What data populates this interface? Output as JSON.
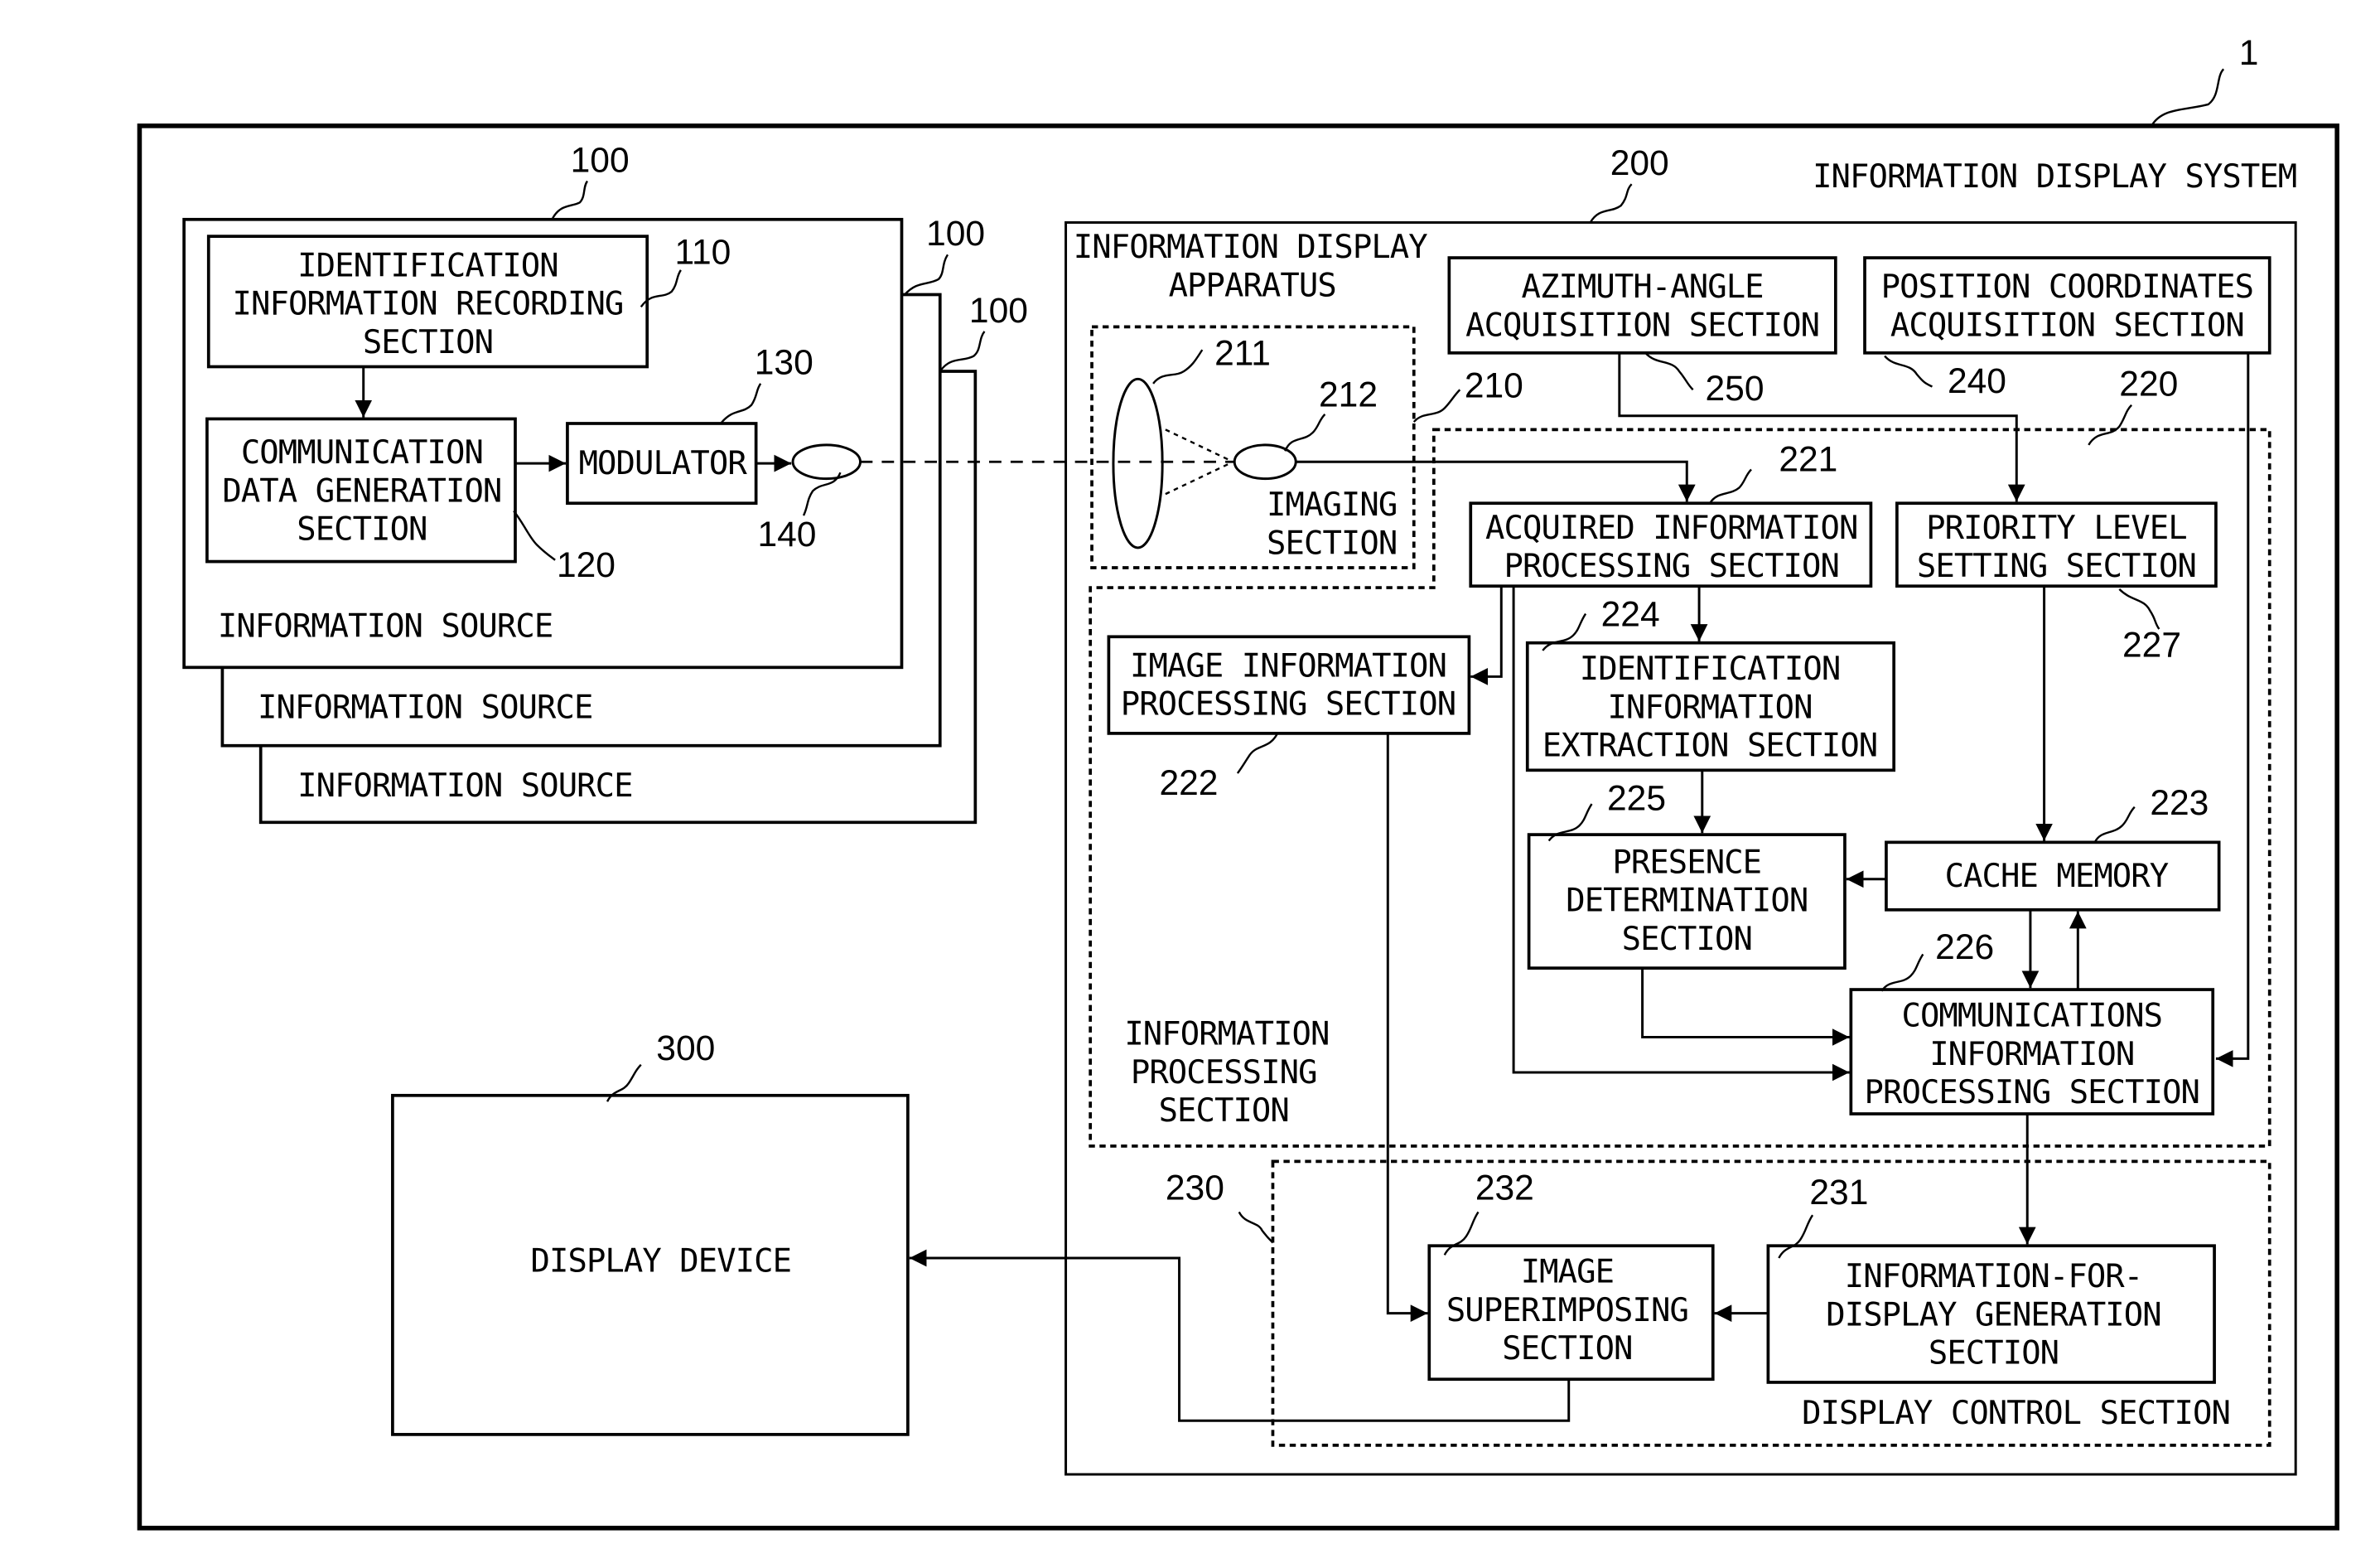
{
  "system": {
    "label": "INFORMATION DISPLAY SYSTEM",
    "ref": "1"
  },
  "sources": {
    "refs": [
      "100",
      "100",
      "100"
    ],
    "labels": [
      "INFORMATION SOURCE",
      "INFORMATION SOURCE",
      "INFORMATION SOURCE"
    ],
    "id_recording": {
      "lines": [
        "IDENTIFICATION",
        "INFORMATION RECORDING",
        "SECTION"
      ],
      "ref": "110"
    },
    "comm_data_gen": {
      "lines": [
        "COMMUNICATION",
        "DATA GENERATION",
        "SECTION"
      ],
      "ref": "120"
    },
    "modulator": {
      "label": "MODULATOR",
      "ref": "130"
    },
    "emitter_ref": "140"
  },
  "apparatus": {
    "lines": [
      "INFORMATION DISPLAY",
      "APPARATUS"
    ],
    "ref": "200",
    "imaging": {
      "lines": [
        "IMAGING",
        "SECTION"
      ],
      "ref": "210",
      "lens_ref": "211",
      "sensor_ref": "212"
    },
    "azimuth": {
      "lines": [
        "AZIMUTH-ANGLE",
        "ACQUISITION SECTION"
      ],
      "ref": "250"
    },
    "position": {
      "lines": [
        "POSITION COORDINATES",
        "ACQUISITION SECTION"
      ],
      "ref": "240"
    },
    "processing": {
      "lines": [
        "INFORMATION",
        "PROCESSING",
        "SECTION"
      ],
      "ref": "220",
      "acquired": {
        "lines": [
          "ACQUIRED INFORMATION",
          "PROCESSING SECTION"
        ],
        "ref": "221"
      },
      "priority": {
        "lines": [
          "PRIORITY LEVEL",
          "SETTING SECTION"
        ],
        "ref": "227"
      },
      "image_info": {
        "lines": [
          "IMAGE INFORMATION",
          "PROCESSING SECTION"
        ],
        "ref": "222"
      },
      "id_extract": {
        "lines": [
          "IDENTIFICATION",
          "INFORMATION",
          "EXTRACTION SECTION"
        ],
        "ref": "224"
      },
      "presence": {
        "lines": [
          "PRESENCE",
          "DETERMINATION",
          "SECTION"
        ],
        "ref": "225"
      },
      "cache": {
        "label": "CACHE MEMORY",
        "ref": "223"
      },
      "comms": {
        "lines": [
          "COMMUNICATIONS",
          "INFORMATION",
          "PROCESSING SECTION"
        ],
        "ref": "226"
      }
    },
    "display_control": {
      "label": "DISPLAY CONTROL SECTION",
      "ref": "230",
      "superimpose": {
        "lines": [
          "IMAGE",
          "SUPERIMPOSING",
          "SECTION"
        ],
        "ref": "232"
      },
      "info_for_display": {
        "lines": [
          "INFORMATION-FOR-",
          "DISPLAY GENERATION",
          "SECTION"
        ],
        "ref": "231"
      }
    }
  },
  "display_device": {
    "label": "DISPLAY DEVICE",
    "ref": "300"
  }
}
